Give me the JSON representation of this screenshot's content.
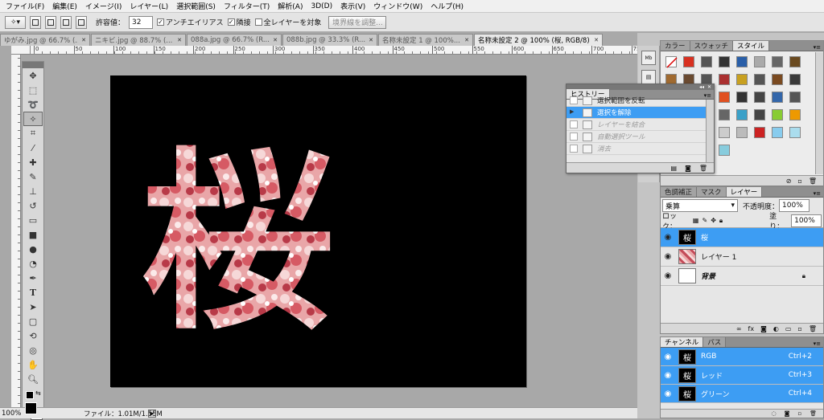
{
  "menu": [
    "ファイル(F)",
    "編集(E)",
    "イメージ(I)",
    "レイヤー(L)",
    "選択範囲(S)",
    "フィルター(T)",
    "解析(A)",
    "3D(D)",
    "表示(V)",
    "ウィンドウ(W)",
    "ヘルプ(H)"
  ],
  "options": {
    "tolerance_label": "許容値：",
    "tolerance_value": "32",
    "antialias_label": "アンチエイリアス",
    "contiguous_label": "隣接",
    "all_layers_label": "全レイヤーを対象",
    "refine_edge_label": "境界線を調整..."
  },
  "doc_tabs": [
    {
      "label": "ゆがみ.jpg @ 66.7% (..."
    },
    {
      "label": "ニキビ.jpg @ 88.7% (..."
    },
    {
      "label": "088a.jpg @ 66.7% (R..."
    },
    {
      "label": "088b.jpg @ 33.3% (R..."
    },
    {
      "label": "名称未設定 1 @ 100%..."
    },
    {
      "label": "名称未設定 2 @ 100% (桜, RGB/8) *"
    }
  ],
  "ruler_labels": [
    "0",
    "50",
    "100",
    "150",
    "200",
    "250",
    "300",
    "350",
    "400",
    "450",
    "500",
    "550",
    "600",
    "650",
    "700",
    "750"
  ],
  "canvas": {
    "character": "桜"
  },
  "status": {
    "zoom": "100%",
    "file_info": "ファイル：1.01M/1.55M"
  },
  "styles_panel": {
    "tabs": [
      "カラー",
      "スウォッチ",
      "スタイル"
    ],
    "active_tab": 2,
    "swatch_colors": [
      "#ffffff",
      "#d83020",
      "#555555",
      "#333333",
      "#2a5fa8",
      "#aaaaaa",
      "#666666",
      "#6a4a20",
      "#a06a30",
      "#6a4a30",
      "#555555",
      "#aa3030",
      "#c8a020",
      "#555555",
      "#7a4a20",
      "#3a3a3a",
      "#7a5a3a",
      "#e0c000",
      "#cc2020",
      "#e05020",
      "#333333",
      "#444444",
      "#3366aa",
      "#555555",
      "#c8c8c8",
      "#b8b8b8",
      "#999999",
      "#666666",
      "#3aa0c8",
      "#444444",
      "#88cc33",
      "#ee9900",
      "#22aadd",
      "#eeeeee",
      "#dddddd",
      "#cccccc",
      "#bbbbbb",
      "#cc2222",
      "#88ccee",
      "#aaddee",
      "#ffbb00",
      "#66aadd",
      "#eeeeee",
      "#88ccdd"
    ]
  },
  "history_panel": {
    "title": "ヒストリー",
    "items": [
      {
        "label": "選択範囲を反転",
        "state": "normal"
      },
      {
        "label": "選択を解除",
        "state": "selected"
      },
      {
        "label": "レイヤーを結合",
        "state": "undone"
      },
      {
        "label": "自動選択ツール",
        "state": "undone"
      },
      {
        "label": "消去",
        "state": "undone"
      },
      {
        "label": "自動選択ツール",
        "state": "undone"
      }
    ]
  },
  "layers_panel": {
    "tabs": [
      "色調補正",
      "マスク",
      "レイヤー"
    ],
    "active_tab": 2,
    "blend_mode": "乗算",
    "opacity_label": "不透明度：",
    "opacity": "100%",
    "lock_label": "ロック：",
    "fill_label": "塗り：",
    "fill": "100%",
    "layers": [
      {
        "name": "桜",
        "thumb": "桜",
        "selected": true
      },
      {
        "name": "レイヤー 1",
        "thumb": "",
        "selected": false
      },
      {
        "name": "背景",
        "thumb": "",
        "selected": false,
        "locked": true
      }
    ]
  },
  "channels_panel": {
    "tabs": [
      "チャンネル",
      "パス"
    ],
    "active_tab": 0,
    "channels": [
      {
        "name": "RGB",
        "shortcut": "Ctrl+2",
        "thumb": "桜"
      },
      {
        "name": "レッド",
        "shortcut": "Ctrl+3",
        "thumb": "桜"
      },
      {
        "name": "グリーン",
        "shortcut": "Ctrl+4",
        "thumb": "桜"
      }
    ]
  },
  "colors": {
    "accent": "#3d9df3",
    "canvas_bg": "#000000",
    "pink": "#e88a90"
  }
}
